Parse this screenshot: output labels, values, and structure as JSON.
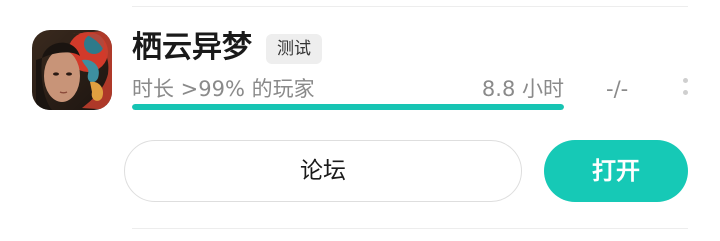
{
  "game": {
    "title": "栖云异梦",
    "badge": "测试",
    "icon": "game-app-icon"
  },
  "stats": {
    "playtime_label": "时长 >99% 的玩家",
    "playtime_value": "8.8 小时",
    "playtime_progress_fraction": 1.0,
    "score": "-/-"
  },
  "actions": {
    "forum_label": "论坛",
    "open_label": "打开"
  },
  "colors": {
    "accent": "#16c9b6",
    "progress": "#16c4b3",
    "muted_text": "#8a8a8a"
  }
}
